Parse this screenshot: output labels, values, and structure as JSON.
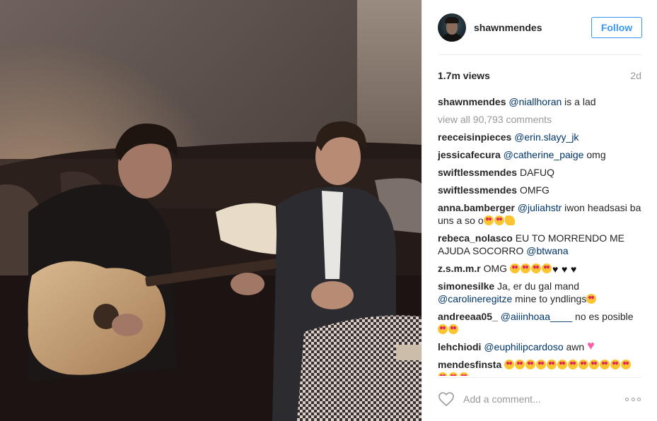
{
  "post": {
    "username": "shawnmendes",
    "follow_label": "Follow",
    "views": "1.7m views",
    "age": "2d",
    "caption": {
      "author": "shawnmendes",
      "mention": "@niallhoran",
      "text": " is a lad"
    },
    "view_all_label": "view all 90,793 comments"
  },
  "comments": [
    {
      "author": "reeceisinpieces",
      "mention": "@erin.slayy_jk",
      "text": "",
      "emojis": []
    },
    {
      "author": "jessicafecura",
      "mention": "@catherine_paige",
      "text": " omg",
      "emojis": []
    },
    {
      "author": "swiftlessmendes",
      "mention": "",
      "text": "DAFUQ",
      "emojis": []
    },
    {
      "author": "swiftlessmendes",
      "mention": "",
      "text": "OMFG",
      "emojis": []
    },
    {
      "author": "anna.bamberger",
      "mention": "@juliahstr",
      "text": " iwon headsasi ba uns a so o",
      "emojis": [
        "heart-eyes",
        "heart-eyes",
        "muscle"
      ]
    },
    {
      "author": "rebeca_nolasco",
      "mention": "",
      "text": "EU TO MORRENDO ME AJUDA SOCORRO ",
      "mention2": "@btwana",
      "emojis": []
    },
    {
      "author": "z.s.m.m.r",
      "mention": "",
      "text": "OMG ",
      "emojis": [
        "heart-eyes",
        "heart-eyes",
        "heart-eyes",
        "heart-eyes",
        "heart-black",
        "heart-black",
        "heart-black"
      ]
    },
    {
      "author": "simonesilke",
      "mention": "",
      "text": "Ja, er du gal mand ",
      "mention2": "@carolineregitze",
      "text2": " mine to yndlings",
      "emojis": [
        "heart-eyes"
      ]
    },
    {
      "author": "andreeaa05_",
      "mention": "@aiiinhoaa____",
      "text": " no es posible ",
      "emojis": [
        "heart-eyes",
        "heart-eyes"
      ]
    },
    {
      "author": "lehchiodi",
      "mention": "@euphilipcardoso",
      "text": " awn ",
      "emojis": [
        "sparkle-heart"
      ]
    },
    {
      "author": "mendesfinsta",
      "mention": "",
      "text": "",
      "emojis": [
        "heart-eyes",
        "heart-eyes",
        "heart-eyes",
        "heart-eyes",
        "heart-eyes",
        "heart-eyes",
        "heart-eyes",
        "heart-eyes",
        "heart-eyes",
        "heart-eyes",
        "heart-eyes",
        "heart-eyes",
        "heart-eyes",
        "heart-eyes",
        "heart-eyes"
      ]
    }
  ],
  "footer": {
    "comment_placeholder": "Add a comment...",
    "like_icon": "heart-outline-icon",
    "more_icon": "more-options-icon"
  },
  "colors": {
    "accent": "#3897f0",
    "mention": "#003569",
    "muted": "#999999",
    "text": "#262626"
  }
}
